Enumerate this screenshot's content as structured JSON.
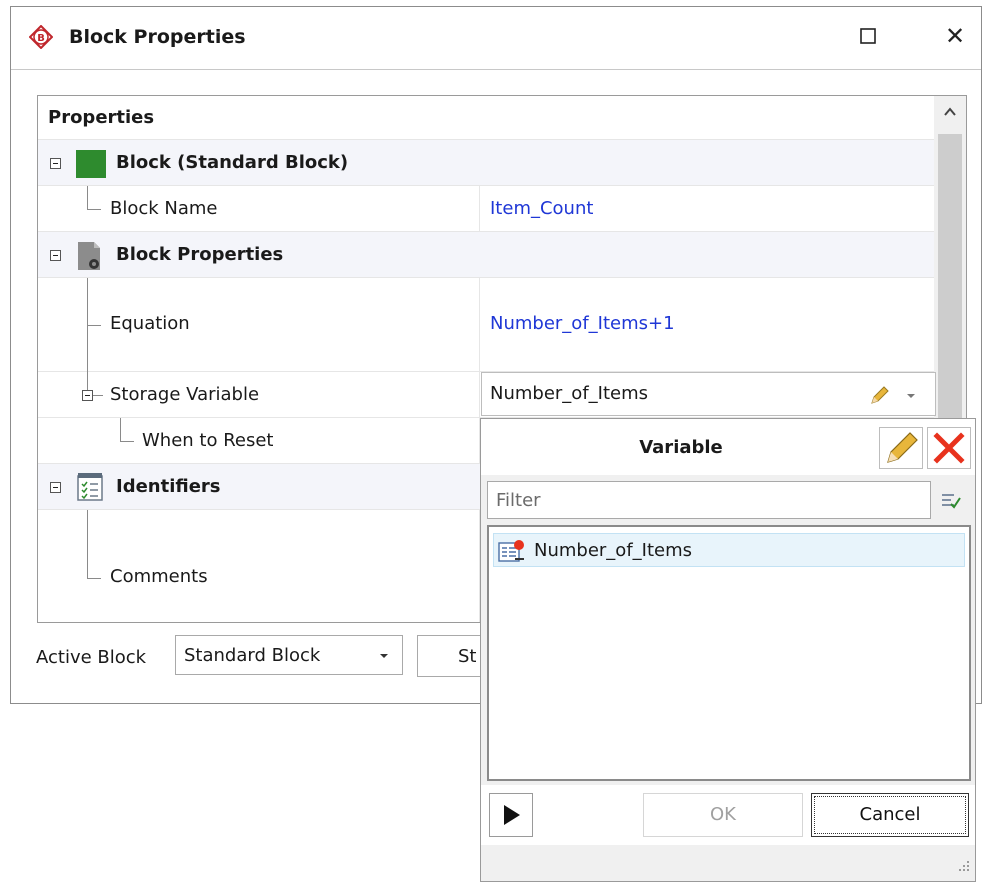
{
  "window": {
    "title": "Block Properties",
    "app_icon_letter": "B"
  },
  "grid": {
    "header": "Properties",
    "categories": [
      {
        "title": "Block (Standard Block)",
        "color": "#2e8b2e"
      },
      {
        "title": "Block Properties"
      },
      {
        "title": "Identifiers"
      }
    ],
    "rows": {
      "block_name": {
        "label": "Block Name",
        "value": "Item_Count"
      },
      "equation": {
        "label": "Equation",
        "value": "Number_of_Items+1"
      },
      "storage_variable": {
        "label": "Storage Variable",
        "value": "Number_of_Items"
      },
      "when_to_reset": {
        "label": "When to Reset"
      },
      "comments": {
        "label": "Comments"
      }
    }
  },
  "footer": {
    "active_block_label": "Active Block",
    "active_block_value": "Standard Block",
    "side_button_label": "St"
  },
  "popup": {
    "title": "Variable",
    "filter_placeholder": "Filter",
    "items": [
      {
        "label": "Number_of_Items",
        "selected": true
      }
    ],
    "ok_label": "OK",
    "cancel_label": "Cancel",
    "close_color": "#e8321d"
  }
}
